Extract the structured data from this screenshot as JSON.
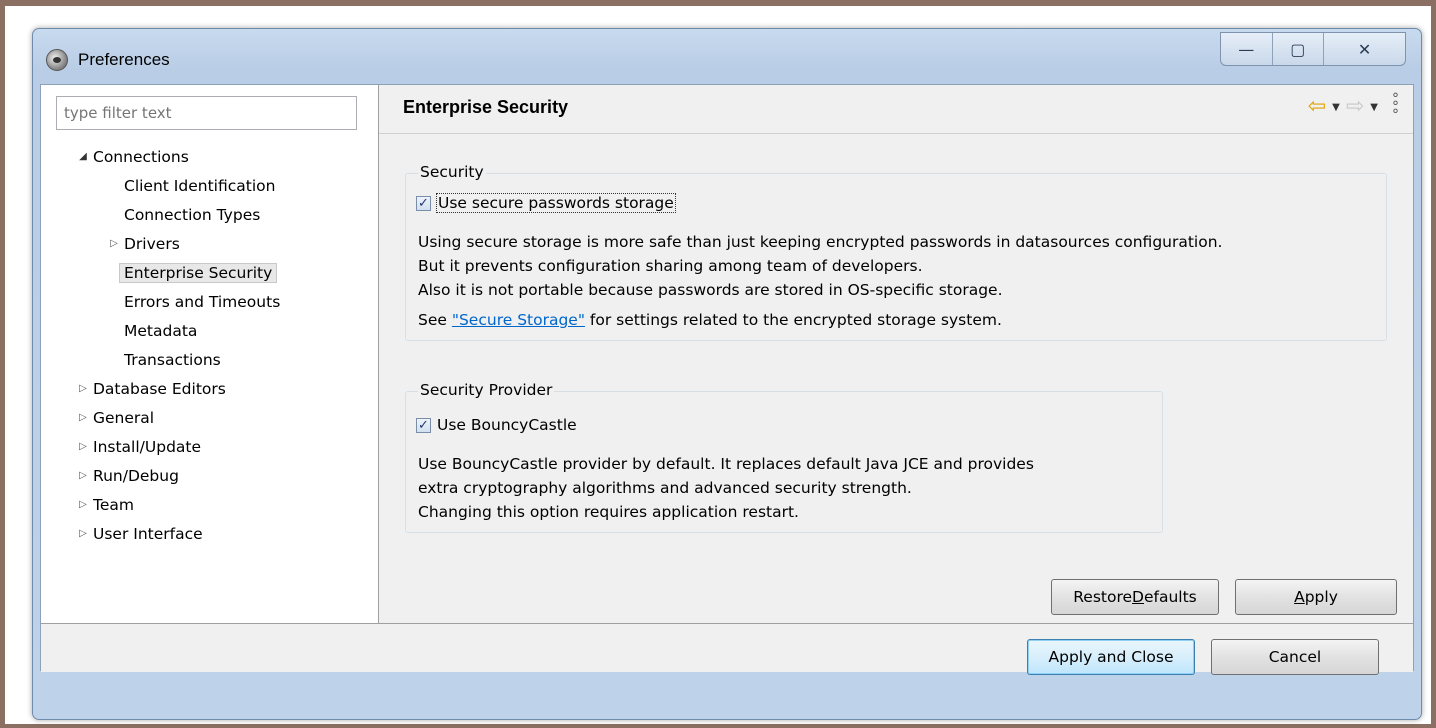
{
  "window": {
    "title": "Preferences",
    "controls": {
      "minimize": "—",
      "maximize": "▢",
      "close": "✕"
    }
  },
  "sidebar": {
    "filter_placeholder": "type filter text",
    "tree": [
      {
        "label": "Connections",
        "expanded": true,
        "children": [
          {
            "label": "Client Identification"
          },
          {
            "label": "Connection Types"
          },
          {
            "label": "Drivers",
            "expandable": true
          },
          {
            "label": "Enterprise Security",
            "selected": true
          },
          {
            "label": "Errors and Timeouts"
          },
          {
            "label": "Metadata"
          },
          {
            "label": "Transactions"
          }
        ]
      },
      {
        "label": "Database Editors"
      },
      {
        "label": "General"
      },
      {
        "label": "Install/Update"
      },
      {
        "label": "Run/Debug"
      },
      {
        "label": "Team"
      },
      {
        "label": "User Interface"
      }
    ]
  },
  "page": {
    "title": "Enterprise Security",
    "security_group": {
      "legend": "Security",
      "checkbox_label": "Use secure passwords storage",
      "checked": true,
      "desc_line1": "Using secure storage is more safe than just keeping encrypted passwords in datasources configuration.",
      "desc_line2": "But it prevents configuration sharing among team of developers.",
      "desc_line3": "Also it is not portable because passwords are stored in OS-specific storage.",
      "see_prefix": "See ",
      "see_link": "\"Secure Storage\"",
      "see_suffix": " for settings related to the encrypted storage system."
    },
    "provider_group": {
      "legend": "Security Provider",
      "checkbox_label": "Use BouncyCastle",
      "checked": true,
      "desc_line1": "Use BouncyCastle provider by default. It replaces default Java JCE and provides",
      "desc_line2": "extra cryptography algorithms and advanced security strength.",
      "desc_line3": "Changing this option requires application restart."
    },
    "restore_defaults_pre": "Restore ",
    "restore_defaults_mnemonic": "D",
    "restore_defaults_post": "efaults",
    "apply_mnemonic": "A",
    "apply_post": "pply"
  },
  "footer": {
    "apply_and_close": "Apply and Close",
    "cancel": "Cancel"
  }
}
